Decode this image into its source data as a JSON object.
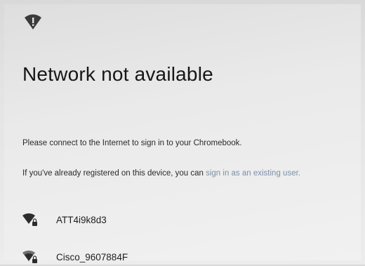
{
  "header": {
    "icon": "wifi-alert-icon",
    "title": "Network not available"
  },
  "message": {
    "line1": "Please connect to the Internet to sign in to your Chromebook.",
    "line2_prefix": "If you've already registered on this device, you can ",
    "line2_link": "sign in as an existing user."
  },
  "networks": [
    {
      "name": "ATT4i9k8d3",
      "icon": "wifi-secured-icon"
    },
    {
      "name": "Cisco_9607884F",
      "icon": "wifi-secured-icon"
    }
  ],
  "colors": {
    "link": "#7d8fa8",
    "text": "#1c1c1c"
  }
}
